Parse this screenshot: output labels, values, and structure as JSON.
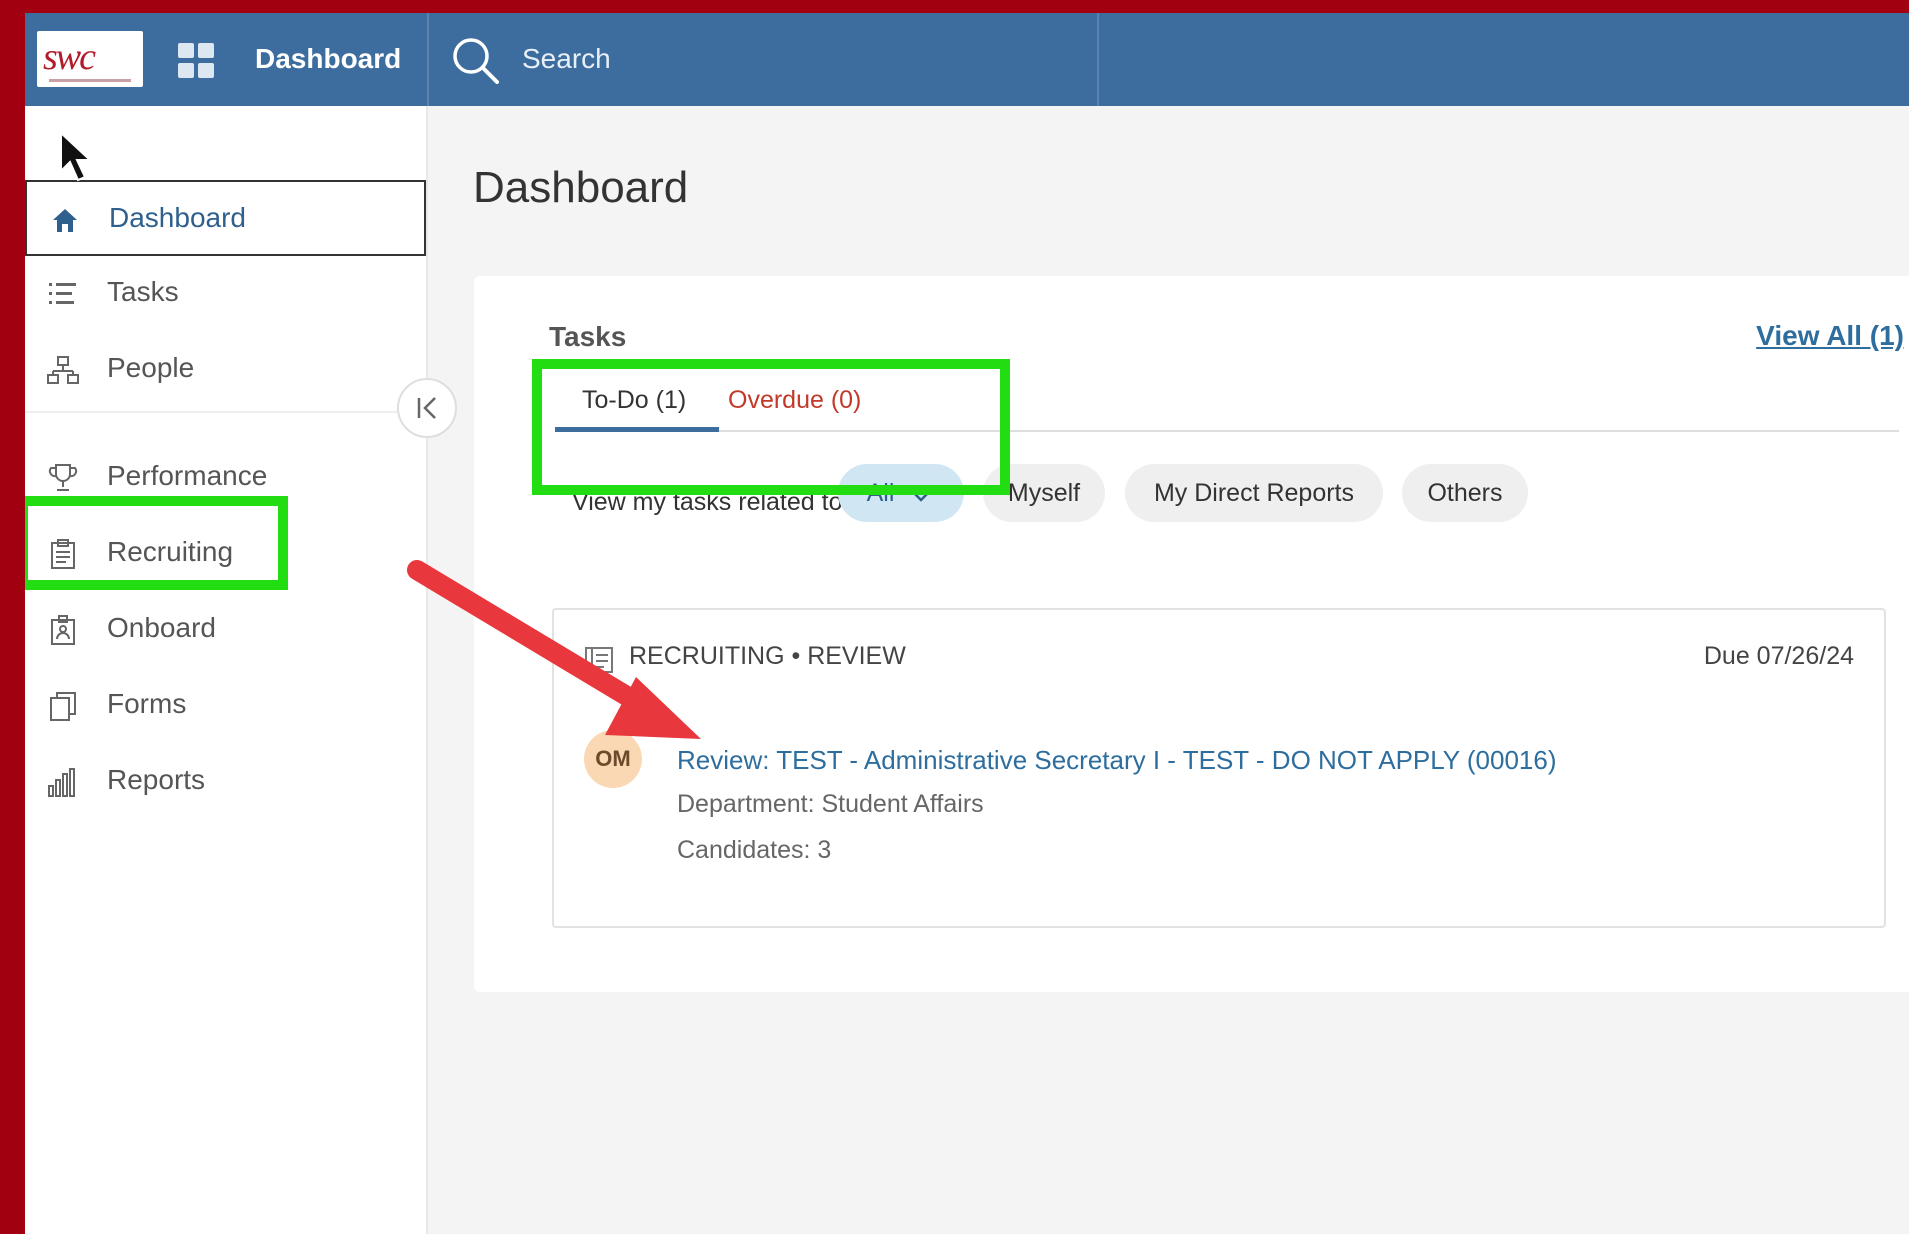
{
  "header": {
    "logo_text": "swc",
    "nav_title": "Dashboard",
    "search_label": "Search"
  },
  "sidebar": {
    "items": [
      {
        "label": "Dashboard",
        "icon": "home-icon"
      },
      {
        "label": "Tasks",
        "icon": "list-icon"
      },
      {
        "label": "People",
        "icon": "org-chart-icon"
      },
      {
        "label": "Performance",
        "icon": "trophy-icon"
      },
      {
        "label": "Recruiting",
        "icon": "clipboard-icon"
      },
      {
        "label": "Onboard",
        "icon": "onboard-icon"
      },
      {
        "label": "Forms",
        "icon": "forms-icon"
      },
      {
        "label": "Reports",
        "icon": "bar-chart-icon"
      }
    ],
    "active": "Dashboard"
  },
  "main": {
    "page_title": "Dashboard",
    "tasks_card": {
      "title": "Tasks",
      "view_all": "View All (1)",
      "tabs": [
        {
          "label": "To-Do (1)",
          "selected": true
        },
        {
          "label": "Overdue (0)",
          "selected": false
        }
      ],
      "filter_label": "View my tasks related to:",
      "filters": [
        {
          "label": "All",
          "selected": true
        },
        {
          "label": "Myself",
          "selected": false
        },
        {
          "label": "My Direct Reports",
          "selected": false
        },
        {
          "label": "Others",
          "selected": false
        }
      ],
      "task": {
        "category": "RECRUITING • REVIEW",
        "due": "Due 07/26/24",
        "avatar_initials": "OM",
        "title": "Review: TEST - Administrative Secretary I - TEST - DO NOT APPLY (00016)",
        "department": "Department: Student Affairs",
        "candidates": "Candidates: 3"
      }
    }
  },
  "annotations": {
    "highlight_color": "#22dd11",
    "arrow_color": "#e8383d"
  }
}
